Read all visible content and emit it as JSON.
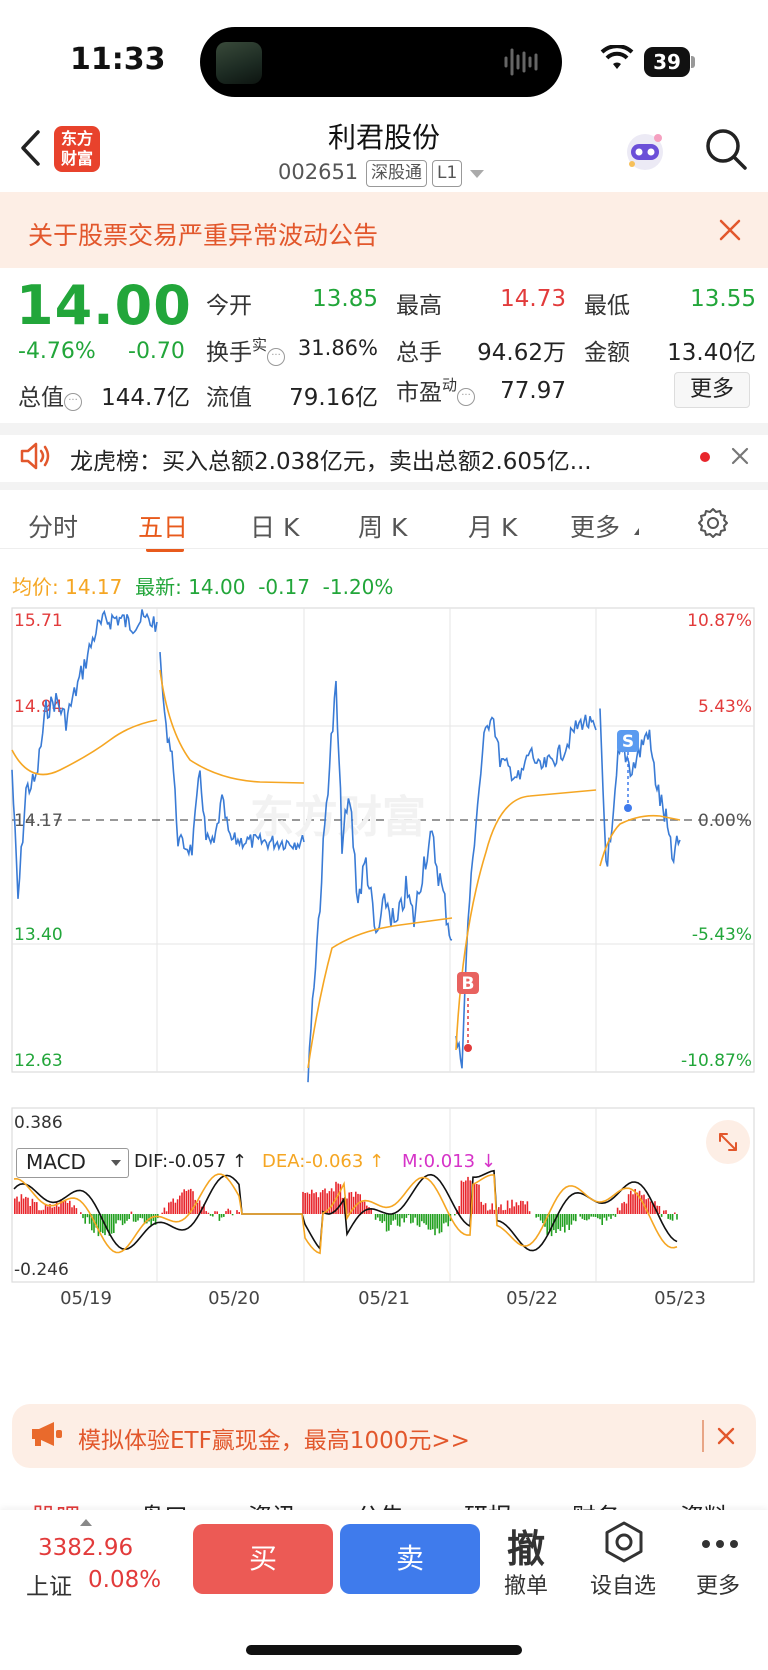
{
  "status": {
    "time": "11:33",
    "battery": "39"
  },
  "header": {
    "logo": "东方财富",
    "name": "利君股份",
    "code": "002651",
    "tags": [
      "深股通",
      "L1"
    ]
  },
  "alert": {
    "text": "关于股票交易严重异常波动公告"
  },
  "quote": {
    "price": "14.00",
    "change_pct": "-4.76%",
    "change": "-0.70",
    "rows": [
      {
        "l1": "今开",
        "v1": "13.85",
        "l2": "最高",
        "v2": "14.73",
        "l3": "最低",
        "v3": "13.55"
      },
      {
        "l1": "换手",
        "l1_sup": "实",
        "v1": "31.86%",
        "l2": "总手",
        "v2": "94.62万",
        "l3": "金额",
        "v3": "13.40亿"
      },
      {
        "l0": "总值",
        "v0": "144.7亿",
        "l1": "流值",
        "v1": "79.16亿",
        "l2": "市盈",
        "l2_sup": "动",
        "v2": "77.97"
      }
    ],
    "more": "更多"
  },
  "news": {
    "text": "龙虎榜：买入总额2.038亿元，卖出总额2.605亿..."
  },
  "tabs": [
    "分时",
    "五日",
    "日 K",
    "周 K",
    "月 K",
    "更多"
  ],
  "active_tab": "五日",
  "info": {
    "avg_label": "均价:",
    "avg": "14.17",
    "latest_label": "最新:",
    "latest": "14.00",
    "chg": "-0.17",
    "pct": "-1.20%"
  },
  "chart": {
    "y_left": [
      "15.71",
      "14.94",
      "14.17",
      "13.40",
      "12.63"
    ],
    "y_right": [
      "10.87%",
      "5.43%",
      "0.00%",
      "-5.43%",
      "-10.87%"
    ],
    "buy_marker": "B",
    "sell_marker": "S",
    "watermark": "东方财富"
  },
  "macd": {
    "selector": "MACD",
    "dif": "DIF:-0.057 ↑",
    "dea": "DEA:-0.063 ↑",
    "m": "M:0.013 ↓",
    "ymax": "0.386",
    "ymin": "-0.246",
    "dates": [
      "05/19",
      "05/20",
      "05/21",
      "05/22",
      "05/23"
    ]
  },
  "etf": {
    "text": "模拟体验ETF赢现金，最高1000元>>"
  },
  "subtabs": [
    "股吧",
    "盘口",
    "资讯",
    "公告",
    "研报",
    "财务",
    "资料"
  ],
  "bottom": {
    "index_value": "3382.96",
    "index_name": "上证",
    "index_pct": "0.08%",
    "buy": "买",
    "sell": "卖",
    "cancel_big": "撤",
    "cancel": "撤单",
    "watch": "设自选",
    "more": "更多"
  },
  "colors": {
    "up": "#e23b3b",
    "down": "#22a63a",
    "price_line": "#3a7bd5",
    "avg_line": "#f5a623",
    "accent": "#e85a1c"
  }
}
